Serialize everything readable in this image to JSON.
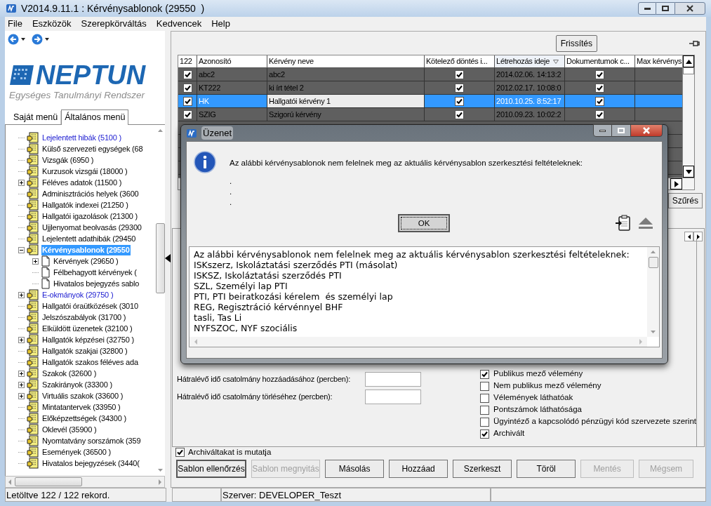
{
  "window": {
    "title": "V2014.9.11.1 : Kérvénysablonok (29550  )"
  },
  "menu": [
    "File",
    "Eszközök",
    "Szerepkörváltás",
    "Kedvencek",
    "Help"
  ],
  "logo": {
    "name": "NEPTUN",
    "subtitle": "Egységes Tanulmányi Rendszer"
  },
  "menu_tabs": [
    {
      "label": "Saját menü",
      "selected": false
    },
    {
      "label": "Általános menü",
      "selected": true
    }
  ],
  "tree": [
    {
      "label": "Lejelentett hibák (5100 )",
      "link": true,
      "selected": false
    },
    {
      "label": "Külső szervezeti egységek (68",
      "link": false,
      "selected": false
    },
    {
      "label": "Vizsgák (6950 )",
      "link": false,
      "selected": false
    },
    {
      "label": "Kurzusok vizsgái (18000 )",
      "link": false,
      "selected": false
    },
    {
      "label": "Féléves adatok (11500 )",
      "expanded": false,
      "link": false,
      "selected": false
    },
    {
      "label": "Adminisztrációs helyek (3600",
      "link": false,
      "selected": false
    },
    {
      "label": "Hallgatók indexei (21250 )",
      "link": false,
      "selected": false
    },
    {
      "label": "Hallgatói igazolások (21300 )",
      "link": false,
      "selected": false
    },
    {
      "label": "Ujjlenyomat beolvasás (29300",
      "link": false,
      "selected": false
    },
    {
      "label": "Lejelentett adathibák (29450",
      "link": false,
      "selected": false
    },
    {
      "label": "Kérvénysablonok (29550",
      "expanded": true,
      "link": false,
      "selected": true,
      "children": [
        {
          "label": "Kérvények (29650 )",
          "expanded": false,
          "link": false,
          "selected": false
        },
        {
          "label": "Félbehagyott kérvények (",
          "link": false,
          "selected": false
        },
        {
          "label": "Hivatalos bejegyzés sablo",
          "link": false,
          "selected": false
        }
      ]
    },
    {
      "label": "E-okmányok (29750 )",
      "expanded": false,
      "link": true,
      "selected": false
    },
    {
      "label": "Hallgatói óraütközések (3010",
      "link": false,
      "selected": false
    },
    {
      "label": "Jelszószabályok (31700 )",
      "link": false,
      "selected": false
    },
    {
      "label": "Elküldött üzenetek (32100 )",
      "link": false,
      "selected": false
    },
    {
      "label": "Hallgatók képzései (32750 )",
      "expanded": false,
      "link": false,
      "selected": false
    },
    {
      "label": "Hallgatók szakjai (32800 )",
      "link": false,
      "selected": false
    },
    {
      "label": "Hallgatók szakos féléves ada",
      "link": false,
      "selected": false
    },
    {
      "label": "Szakok (32600 )",
      "expanded": false,
      "link": false,
      "selected": false
    },
    {
      "label": "Szakirányok (33300 )",
      "expanded": false,
      "link": false,
      "selected": false
    },
    {
      "label": "Virtuális szakok (33600 )",
      "expanded": false,
      "link": false,
      "selected": false
    },
    {
      "label": "Mintatantervek (33950 )",
      "link": false,
      "selected": false
    },
    {
      "label": "Előképzettségek (34300 )",
      "link": false,
      "selected": false
    },
    {
      "label": "Oklevél (35900 )",
      "link": false,
      "selected": false
    },
    {
      "label": "Nyomtatvány sorszámok (359",
      "link": false,
      "selected": false
    },
    {
      "label": "Események (36500 )",
      "link": false,
      "selected": false
    },
    {
      "label": "Hivatalos bejegyzések (3440(",
      "link": false,
      "selected": false
    }
  ],
  "refresh_button": "Frissítés",
  "table": {
    "columns": [
      {
        "label": "122",
        "sorted": false
      },
      {
        "label": "Azonosító",
        "sorted": false
      },
      {
        "label": "Kérvény neve",
        "sorted": false
      },
      {
        "label": "Kötelező döntés i...",
        "sorted": false
      },
      {
        "label": "Létrehozás ideje",
        "sorted": true
      },
      {
        "label": "Dokumentumok c...",
        "sorted": false
      },
      {
        "label": "Max kérvénys",
        "sorted": false
      }
    ],
    "rows": [
      {
        "checked": true,
        "id": "abc2",
        "name": "abc2",
        "mandatory": true,
        "created": "2014.02.06. 14:13:2",
        "documents": true,
        "selected": false
      },
      {
        "checked": true,
        "id": "KT222",
        "name": "ki írt tétel 2",
        "mandatory": true,
        "created": "2012.02.17. 10:08:0",
        "documents": true,
        "selected": false
      },
      {
        "checked": true,
        "id": "HK",
        "name": "Hallgatói kérvény 1",
        "mandatory": true,
        "created": "2010.10.25. 8:52:17",
        "documents": true,
        "selected": true
      },
      {
        "checked": true,
        "id": "SZIG",
        "name": "Szigorú kérvény",
        "mandatory": true,
        "created": "2010.09.23. 10:02:2",
        "documents": true,
        "selected": false
      }
    ]
  },
  "filter_button": "Szűrés",
  "form": {
    "fields": [
      {
        "label": "Hátralévő idő csatolmány hozzáadásához (percben):"
      },
      {
        "label": "Hátralévő idő csatolmány törléséhez (percben):"
      }
    ],
    "checkboxes": [
      {
        "label": "Publikus mező vélemény",
        "checked": true
      },
      {
        "label": "Nem publikus mező vélemény",
        "checked": false
      },
      {
        "label": "Vélemények láthatóak",
        "checked": false
      },
      {
        "label": "Pontszámok láthatósága",
        "checked": false
      },
      {
        "label": "Ügyintéző a kapcsolódó pénzügyi kód szervezete szerint",
        "checked": false
      },
      {
        "label": "Archivált",
        "checked": true
      }
    ]
  },
  "show_archived": {
    "label": "Archiváltakat is mutatja",
    "checked": true
  },
  "buttons": [
    {
      "label": "Sablon ellenőrzés",
      "disabled": false,
      "focused": true
    },
    {
      "label": "Sablon megnyitás",
      "disabled": true,
      "focused": false
    },
    {
      "label": "Másolás",
      "disabled": false,
      "focused": false
    },
    {
      "label": "Hozzáad",
      "disabled": false,
      "focused": false
    },
    {
      "label": "Szerkeszt",
      "disabled": false,
      "focused": false
    },
    {
      "label": "Töröl",
      "disabled": false,
      "focused": false
    },
    {
      "label": "Mentés",
      "disabled": true,
      "focused": false
    },
    {
      "label": "Mégsem",
      "disabled": true,
      "focused": false
    }
  ],
  "status_bar": [
    "Letöltve 122 / 122 rekord.",
    "Szerver: DEVELOPER_Teszt"
  ],
  "dialog": {
    "title": "Üzenet",
    "message": "Az alábbi kérvénysablonok nem felelnek meg az aktuális kérvénysablon szerkesztési feltételeknek:",
    "dots": [
      ".",
      ".",
      "."
    ],
    "ok_button": "OK",
    "details": [
      "Az alábbi kérvénysablonok nem felelnek meg az aktuális kérvénysablon szerkesztési feltételeknek:",
      "ISKszerz, Iskoláztatási szerződés PTI (másolat)",
      "ISKSZ, Iskoláztatási szerződés PTI",
      "SZL, Személyi lap PTI",
      "PTI, PTI beiratkozási kérelem  és személyi lap",
      "REG, Regisztráció kérvénnyel BHF",
      "tasli, Tas Li",
      "NYFSZOC, NYF szociális"
    ]
  }
}
